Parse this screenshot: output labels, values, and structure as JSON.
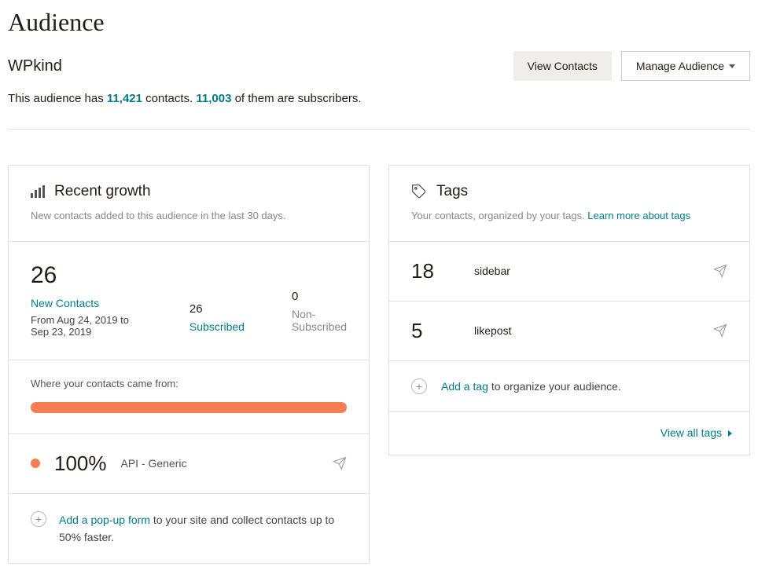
{
  "page_title": "Audience",
  "audience_name": "WPkind",
  "buttons": {
    "view_contacts": "View Contacts",
    "manage_audience": "Manage Audience"
  },
  "summary": {
    "prefix": "This audience has ",
    "contacts": "11,421",
    "mid": " contacts. ",
    "subscribers": "11,003",
    "suffix": " of them are subscribers."
  },
  "growth": {
    "title": "Recent growth",
    "subtitle": "New contacts added to this audience in the last 30 days.",
    "new_count": "26",
    "new_label": "New Contacts",
    "date_range": "From Aug 24, 2019 to Sep 23, 2019",
    "subscribed_count": "26",
    "subscribed_label": "Subscribed",
    "nonsub_count": "0",
    "nonsub_label": "Non-Subscribed",
    "where_label": "Where your contacts came from:",
    "source_pct": "100%",
    "source_name": "API - Generic",
    "popup_link": "Add a pop-up form",
    "popup_rest": " to your site and collect contacts up to 50% faster."
  },
  "tags": {
    "title": "Tags",
    "subtitle_prefix": "Your contacts, organized by your tags. ",
    "learn_more": "Learn more about tags",
    "items": [
      {
        "count": "18",
        "name": "sidebar"
      },
      {
        "count": "5",
        "name": "likepost"
      }
    ],
    "add_link": "Add a tag",
    "add_rest": " to organize your audience.",
    "view_all": "View all tags"
  },
  "chart_data": {
    "type": "bar",
    "title": "Where your contacts came from",
    "categories": [
      "API - Generic"
    ],
    "values": [
      100
    ],
    "xlabel": "",
    "ylabel": "Percent",
    "ylim": [
      0,
      100
    ]
  }
}
